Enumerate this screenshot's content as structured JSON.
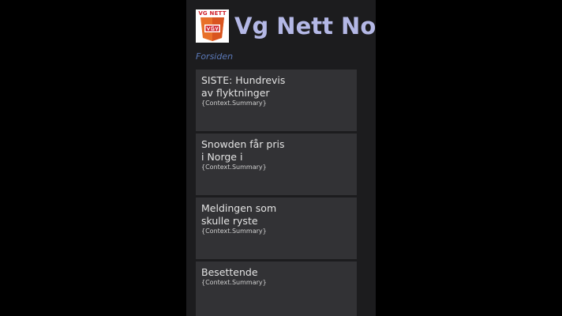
{
  "app": {
    "logo_text": "VG NETT",
    "title": "Vg Nett Norsk"
  },
  "page": {
    "subtitle": "Forsiden"
  },
  "articles": [
    {
      "title": "SISTE: Hundrevis av flyktninger",
      "summary": "{Context.Summary}"
    },
    {
      "title": "Snowden får pris i Norge i",
      "summary": "{Context.Summary}"
    },
    {
      "title": "Meldingen som skulle ryste",
      "summary": "{Context.Summary}"
    },
    {
      "title": "Besettende",
      "summary": "{Context.Summary}"
    }
  ],
  "colors": {
    "background": "#000000",
    "app_background": "#1c1c1e",
    "tile": "#323235",
    "title_accent": "#b4b8e6",
    "subtitle_accent": "#5b79b8",
    "logo_red": "#d0202a",
    "logo_orange": "#e8702a"
  },
  "icons": {
    "logo": "vg-nett-logo-icon"
  }
}
